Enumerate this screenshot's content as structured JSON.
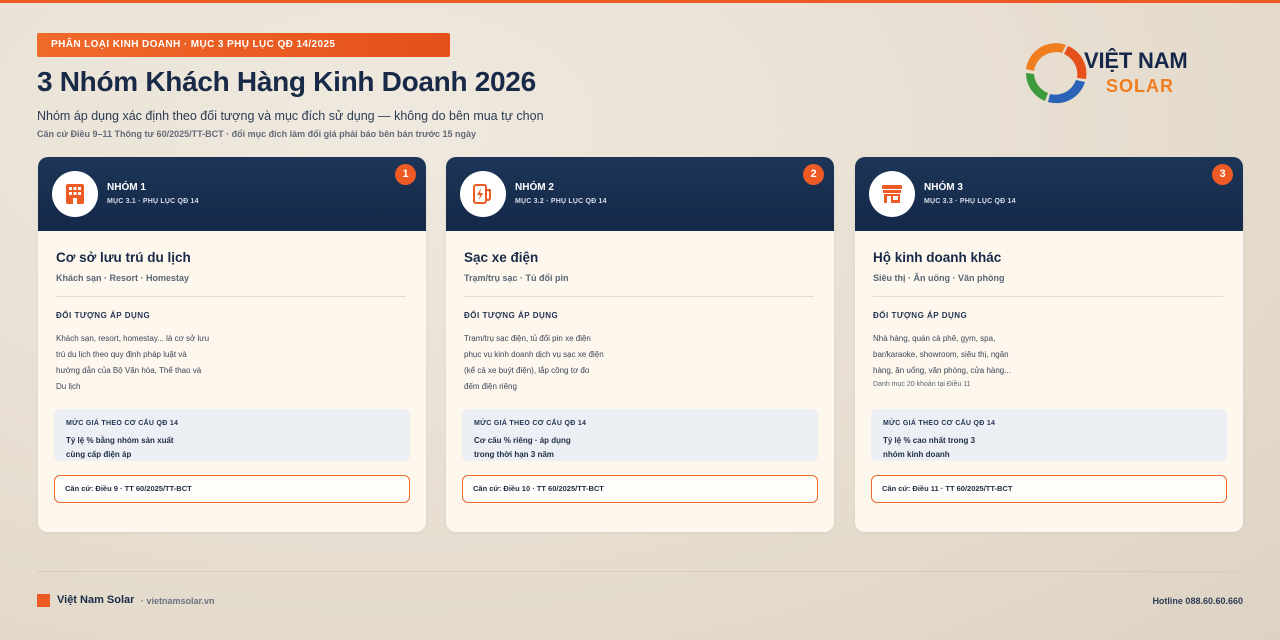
{
  "colors": {
    "accent": "#ee5a24",
    "navy": "#182a47",
    "brand_orange": "#f07d1e"
  },
  "header": {
    "tag": "PHÂN LOẠI KINH DOANH · MỤC 3 PHỤ LỤC QĐ 14/2025",
    "title": "3 Nhóm Khách Hàng Kinh Doanh 2026",
    "subtitle": "Nhóm áp dụng xác định theo đối tượng và mục đích sử dụng — không do bên mua tự chọn",
    "note": "Căn cứ Điều 9–11 Thông tư 60/2025/TT-BCT · đổi mục đích làm đổi giá phải báo bên bán trước 15 ngày"
  },
  "logo": {
    "line1": "VIỆT NAM",
    "line2": "SOLAR"
  },
  "cards": [
    {
      "icon": "building-icon",
      "label": "NHÓM 1",
      "ref": "MỤC 3.1 · PHỤ LỤC QĐ 14",
      "number": "1",
      "title": "Cơ sở lưu trú du lịch",
      "sub": "Khách sạn · Resort · Homestay",
      "section": "ĐỐI TƯỢNG ÁP DỤNG",
      "desc_lines": [
        "Khách sạn, resort, homestay... là cơ sở lưu",
        "trú du lịch theo quy định pháp luật và",
        "hướng dẫn của Bộ Văn hóa, Thể thao và",
        "Du lịch"
      ],
      "extra": "",
      "price_head": "MỨC GIÁ THEO CƠ CẤU QĐ 14",
      "price_lines": [
        "Tỷ lệ % bằng nhóm sản xuất",
        "cùng cấp điện áp"
      ],
      "basis": "Căn cứ: Điều 9 · TT 60/2025/TT-BCT"
    },
    {
      "icon": "ev-charging-icon",
      "label": "NHÓM 2",
      "ref": "MỤC 3.2 · PHỤ LỤC QĐ 14",
      "number": "2",
      "title": "Sạc xe điện",
      "sub": "Trạm/trụ sạc · Tủ đổi pin",
      "section": "ĐỐI TƯỢNG ÁP DỤNG",
      "desc_lines": [
        "Trạm/trụ sạc điện, tủ đổi pin xe điện",
        "phục vụ kinh doanh dịch vụ sạc xe điện",
        "(kể cả xe buýt điện), lắp công tơ đo",
        "đếm điện riêng"
      ],
      "extra": "",
      "price_head": "MỨC GIÁ THEO CƠ CẤU QĐ 14",
      "price_lines": [
        "Cơ cấu % riêng · áp dụng",
        "trong thời hạn 3 năm"
      ],
      "basis": "Căn cứ: Điều 10 · TT 60/2025/TT-BCT"
    },
    {
      "icon": "storefront-icon",
      "label": "NHÓM 3",
      "ref": "MỤC 3.3 · PHỤ LỤC QĐ 14",
      "number": "3",
      "title": "Hộ kinh doanh khác",
      "sub": "Siêu thị · Ăn uống · Văn phòng",
      "section": "ĐỐI TƯỢNG ÁP DỤNG",
      "desc_lines": [
        "Nhà hàng, quán cà phê, gym, spa,",
        "bar/karaoke, showroom, siêu thị, ngân",
        "hàng, ăn uống, văn phòng, cửa hàng..."
      ],
      "extra": "Danh mục 20 khoản tại Điều 11",
      "price_head": "MỨC GIÁ THEO CƠ CẤU QĐ 14",
      "price_lines": [
        "Tỷ lệ % cao nhất trong 3",
        "nhóm kinh doanh"
      ],
      "basis": "Căn cứ: Điều 11 · TT 60/2025/TT-BCT"
    }
  ],
  "footer": {
    "brand": "Việt Nam Solar",
    "site": "· vietnamsolar.vn",
    "hotline": "Hotline 088.60.60.660"
  }
}
